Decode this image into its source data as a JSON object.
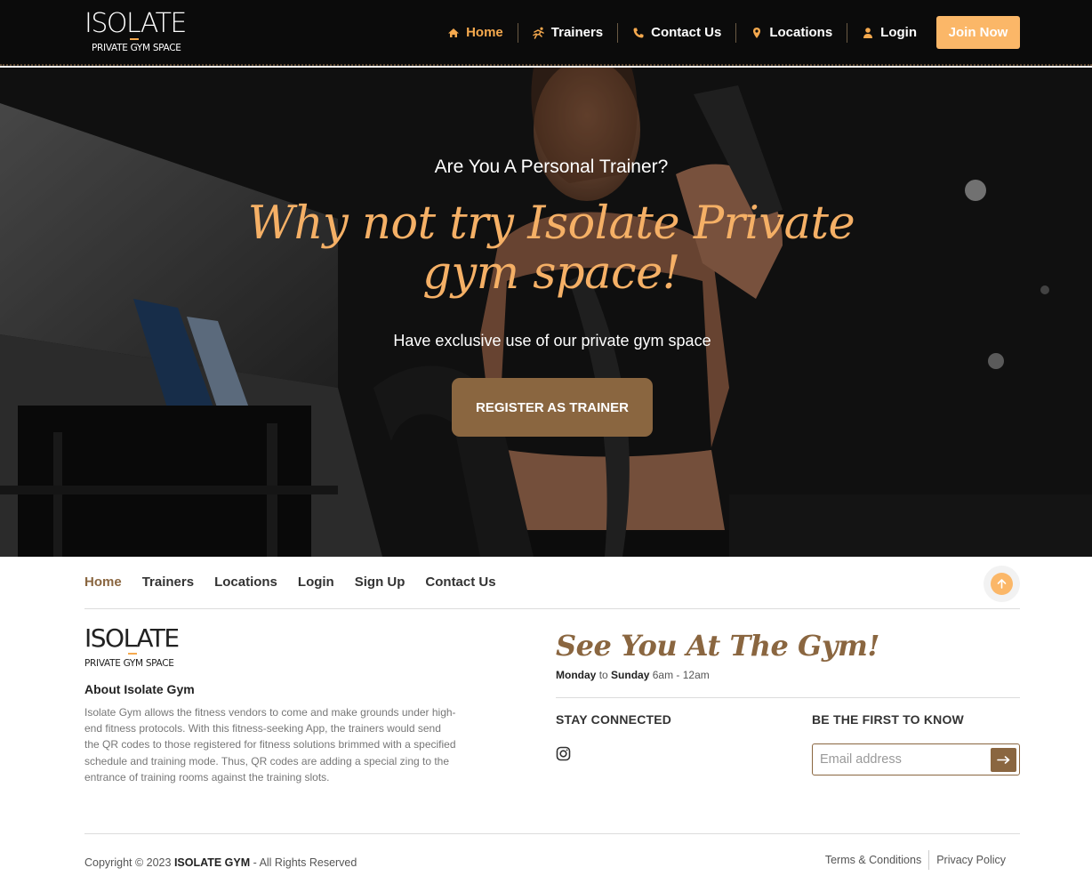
{
  "brand": {
    "logo_main": "ISOLATE",
    "logo_sub": "PRIVATE GYM SPACE"
  },
  "nav": {
    "items": [
      {
        "label": "Home",
        "icon": "home-icon"
      },
      {
        "label": "Trainers",
        "icon": "runner-icon"
      },
      {
        "label": "Contact Us",
        "icon": "phone-icon"
      },
      {
        "label": "Locations",
        "icon": "map-pin-icon"
      },
      {
        "label": "Login",
        "icon": "user-icon"
      }
    ],
    "join_label": "Join Now"
  },
  "hero": {
    "kicker": "Are You A Personal Trainer?",
    "title": "Why not try Isolate Private gym space!",
    "subtitle": "Have exclusive use of our private gym space",
    "button_label": "REGISTER AS TRAINER"
  },
  "footer": {
    "nav": [
      "Home",
      "Trainers",
      "Locations",
      "Login",
      "Sign Up",
      "Contact Us"
    ],
    "about_title": "About Isolate Gym",
    "about_text": "Isolate Gym allows the fitness vendors to come and make grounds under high-end fitness protocols. With this fitness-seeking App, the trainers would send the QR codes to those registered for fitness solutions brimmed with a specified schedule and training mode. Thus, QR codes are adding a special zing to the entrance of training rooms against the training slots.",
    "see_title": "See You At The Gym!",
    "hours": {
      "day_from": "Monday",
      "to": "to",
      "day_to": "Sunday",
      "time": "6am - 12am"
    },
    "stay_connected": "STAY CONNECTED",
    "first_to_know": "BE THE FIRST TO KNOW",
    "email_placeholder": "Email address",
    "copyright_prefix": "Copyright © 2023",
    "copyright_brand": "ISOLATE GYM",
    "copyright_suffix": "- All Rights Reserved",
    "terms": "Terms & Conditions",
    "privacy": "Privacy Policy"
  },
  "colors": {
    "accent": "#f5a94e",
    "brown": "#8a6640",
    "nav_bg": "#0b0b0b"
  }
}
